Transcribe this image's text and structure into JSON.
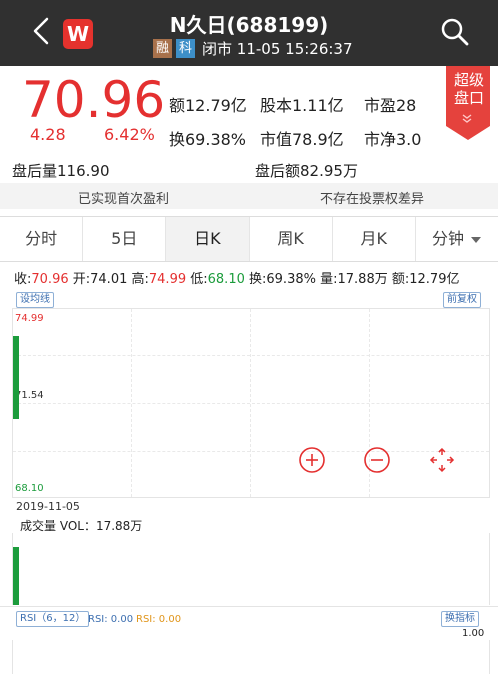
{
  "header": {
    "logo_letter": "W",
    "title": "N久日(688199)",
    "tag_rong": "融",
    "tag_ke": "科",
    "status": "闭市 11-05 15:26:37"
  },
  "quote": {
    "price": "70.96",
    "change": "4.28",
    "change_pct": "6.42%",
    "amount_label": "额12.79亿",
    "share_capital": "股本1.11亿",
    "pe": "市盈28",
    "turnover": "换69.38%",
    "market_cap": "市值78.9亿",
    "pb": "市净3.0",
    "badge_line1": "超级",
    "badge_line2": "盘口"
  },
  "after_hours": {
    "volume": "盘后量116.90",
    "amount": "盘后额82.95万"
  },
  "notices": {
    "left": "已实现首次盈利",
    "right": "不存在投票权差异"
  },
  "tabs": [
    "分时",
    "5日",
    "日K",
    "周K",
    "月K",
    "分钟"
  ],
  "active_tab": 2,
  "info_line": {
    "close": "70.96",
    "open": "74.01",
    "high": "74.99",
    "low": "68.10",
    "turnover": "69.38%",
    "volume": "17.88万",
    "amount": "12.79亿"
  },
  "buttons": {
    "ma_settings": "设均线",
    "adjust": "前复权",
    "switch_indicator": "换指标"
  },
  "chart": {
    "axis_high": "74.99",
    "axis_mid": "71.54",
    "axis_low": "68.10",
    "date": "2019-11-05",
    "volume_label": "成交量 VOL：17.88万"
  },
  "chart_data": {
    "type": "bar",
    "categories": [
      "2019-11-05"
    ],
    "open": [
      74.01
    ],
    "high": [
      74.99
    ],
    "low": [
      68.1
    ],
    "close": [
      70.96
    ],
    "volume": [
      17.88
    ],
    "ylim": [
      68.1,
      74.99
    ]
  },
  "rsi": {
    "label": "RSI（6，12）",
    "rsi1": "RSI: 0.00",
    "rsi2": "RSI: 0.00",
    "max_value": "1.00"
  },
  "colors": {
    "up": "#e43030",
    "down": "#1c9c3c",
    "header_bg": "#303030"
  }
}
